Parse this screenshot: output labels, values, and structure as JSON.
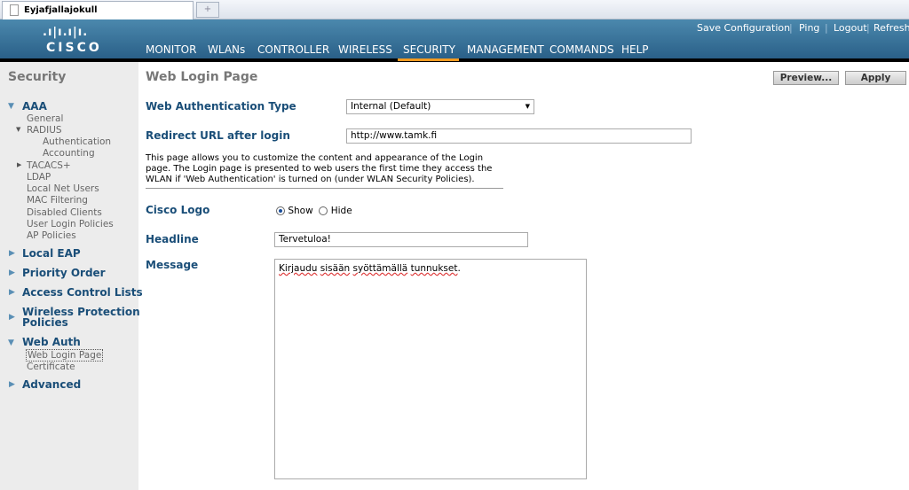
{
  "browser": {
    "tab_title": "Eyjafjallajokull",
    "new_tab": "+"
  },
  "header": {
    "logo": "cisco",
    "nav": [
      "MONITOR",
      "WLANs",
      "CONTROLLER",
      "WIRELESS",
      "SECURITY",
      "MANAGEMENT",
      "COMMANDS",
      "HELP"
    ],
    "active_nav": "SECURITY",
    "links": [
      "Save Configuration",
      "Ping",
      "Logout",
      "Refresh"
    ],
    "separator": "|"
  },
  "sidebar": {
    "title": "Security",
    "aaa": "AAA",
    "general": "General",
    "radius": "RADIUS",
    "authentication": "Authentication",
    "accounting": "Accounting",
    "tacacs": "TACACS+",
    "ldap": "LDAP",
    "local_net_users": "Local Net Users",
    "mac_filtering": "MAC Filtering",
    "disabled_clients": "Disabled Clients",
    "user_login_policies": "User Login Policies",
    "ap_policies": "AP Policies",
    "local_eap": "Local EAP",
    "priority_order": "Priority Order",
    "acl": "Access Control Lists",
    "wpp1": "Wireless Protection",
    "wpp2": "Policies",
    "web_auth": "Web Auth",
    "web_login_page": "Web Login Page",
    "certificate": "Certificate",
    "advanced": "Advanced"
  },
  "main": {
    "title": "Web Login Page",
    "preview": "Preview...",
    "apply": "Apply",
    "auth_type_label": "Web Authentication Type",
    "auth_type_value": "Internal (Default)",
    "redirect_label": "Redirect URL after login",
    "redirect_value": "http://www.tamk.fi",
    "help": "This page allows you to customize the content and appearance of the Login page. The Login page is presented to web users the first time they access the WLAN if 'Web Authentication' is turned on (under WLAN Security Policies).",
    "logo_label": "Cisco Logo",
    "show": "Show",
    "hide": "Hide",
    "logo_selected": "Show",
    "headline_label": "Headline",
    "headline_value": "Tervetuloa!",
    "message_label": "Message",
    "message_words": [
      "Kirjaudu",
      "sisään",
      "syöttämällä",
      "tunnukset"
    ],
    "message_end": "."
  },
  "colors": {
    "header": "#2a6088",
    "accent": "#f29b21",
    "label": "#1a4e78"
  }
}
